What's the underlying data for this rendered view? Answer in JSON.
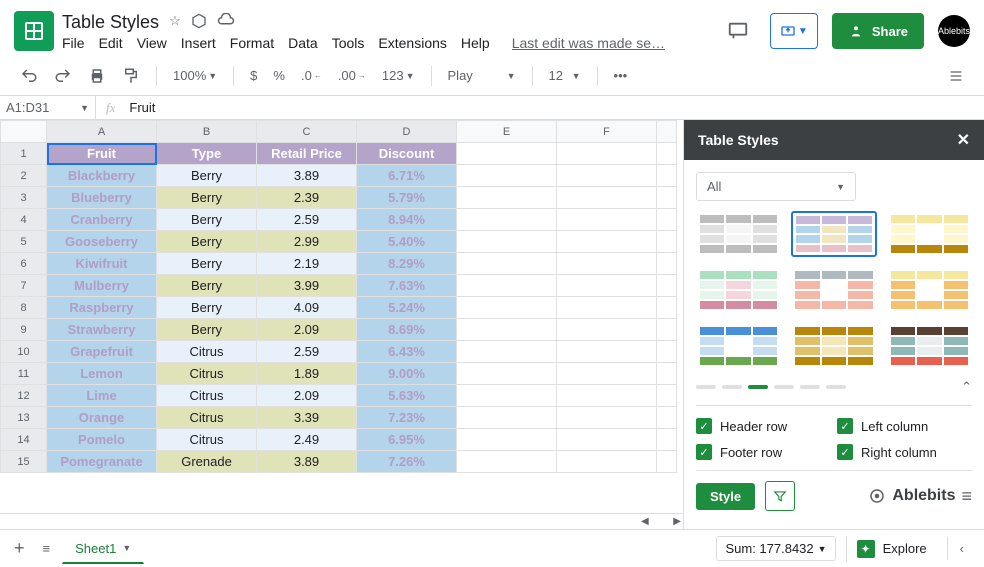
{
  "doc": {
    "title": "Table Styles",
    "lastEdit": "Last edit was made se…"
  },
  "menu": {
    "file": "File",
    "edit": "Edit",
    "view": "View",
    "insert": "Insert",
    "format": "Format",
    "data": "Data",
    "tools": "Tools",
    "extensions": "Extensions",
    "help": "Help"
  },
  "toolbar": {
    "zoom": "100%",
    "currency": "$",
    "percent": "%",
    "moreFormats": "123",
    "font": "Play",
    "fontSize": "12"
  },
  "namebox": "A1:D31",
  "formula": "Fruit",
  "columns": [
    "A",
    "B",
    "C",
    "D",
    "E",
    "F"
  ],
  "headerRow": [
    "Fruit",
    "Type",
    "Retail Price",
    "Discount"
  ],
  "rows": [
    {
      "n": "2",
      "a": "Blackberry",
      "b": "Berry",
      "c": "3.89",
      "d": "6.71%"
    },
    {
      "n": "3",
      "a": "Blueberry",
      "b": "Berry",
      "c": "2.39",
      "d": "5.79%"
    },
    {
      "n": "4",
      "a": "Cranberry",
      "b": "Berry",
      "c": "2.59",
      "d": "8.94%"
    },
    {
      "n": "5",
      "a": "Gooseberry",
      "b": "Berry",
      "c": "2.99",
      "d": "5.40%"
    },
    {
      "n": "6",
      "a": "Kiwifruit",
      "b": "Berry",
      "c": "2.19",
      "d": "8.29%"
    },
    {
      "n": "7",
      "a": "Mulberry",
      "b": "Berry",
      "c": "3.99",
      "d": "7.63%"
    },
    {
      "n": "8",
      "a": "Raspberry",
      "b": "Berry",
      "c": "4.09",
      "d": "5.24%"
    },
    {
      "n": "9",
      "a": "Strawberry",
      "b": "Berry",
      "c": "2.09",
      "d": "8.69%"
    },
    {
      "n": "10",
      "a": "Grapefruit",
      "b": "Citrus",
      "c": "2.59",
      "d": "6.43%"
    },
    {
      "n": "11",
      "a": "Lemon",
      "b": "Citrus",
      "c": "1.89",
      "d": "9.00%"
    },
    {
      "n": "12",
      "a": "Lime",
      "b": "Citrus",
      "c": "2.09",
      "d": "5.63%"
    },
    {
      "n": "13",
      "a": "Orange",
      "b": "Citrus",
      "c": "3.39",
      "d": "7.23%"
    },
    {
      "n": "14",
      "a": "Pomelo",
      "b": "Citrus",
      "c": "2.49",
      "d": "6.95%"
    },
    {
      "n": "15",
      "a": "Pomegranate",
      "b": "Grenade",
      "c": "3.89",
      "d": "7.26%"
    }
  ],
  "sidepanel": {
    "title": "Table Styles",
    "filter": "All",
    "checks": {
      "headerRow": "Header row",
      "leftColumn": "Left column",
      "footerRow": "Footer row",
      "rightColumn": "Right column"
    },
    "styleBtn": "Style",
    "brand": "Ablebits"
  },
  "bottom": {
    "sheet": "Sheet1",
    "sum": "Sum: 177.8432",
    "explore": "Explore"
  },
  "share": "Share",
  "avatar": "Ablebits"
}
